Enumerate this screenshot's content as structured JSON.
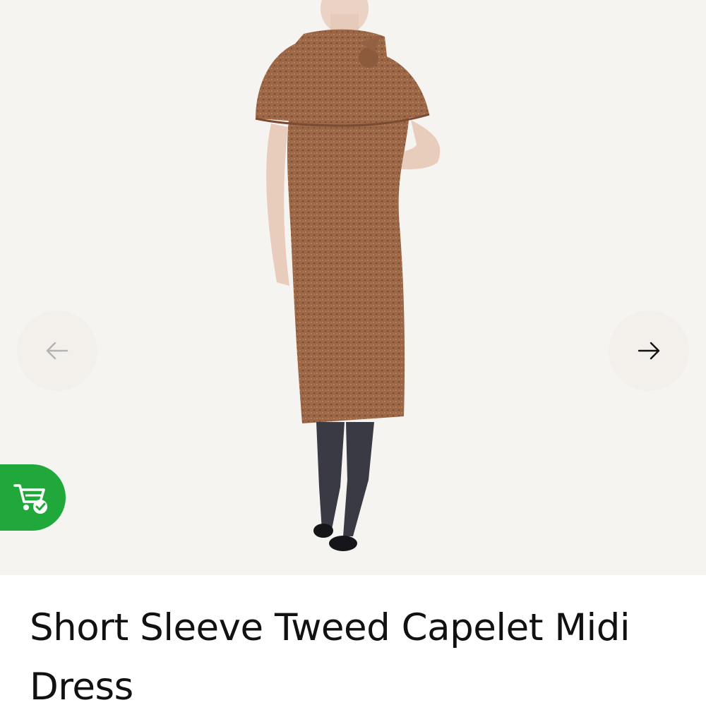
{
  "product": {
    "title": "Short Sleeve Tweed Capelet Midi Dress",
    "image_alt": "Model wearing short sleeve tweed capelet midi dress",
    "colors": {
      "gallery_bg": "#f6f4f1",
      "dress": "#9c6746",
      "nav_button_bg": "#f3f0ec",
      "cart_badge": "#21a83b"
    }
  },
  "gallery": {
    "prev_icon": "arrow-left-icon",
    "next_icon": "arrow-right-icon"
  },
  "cart_badge": {
    "icon": "cart-check-icon"
  }
}
